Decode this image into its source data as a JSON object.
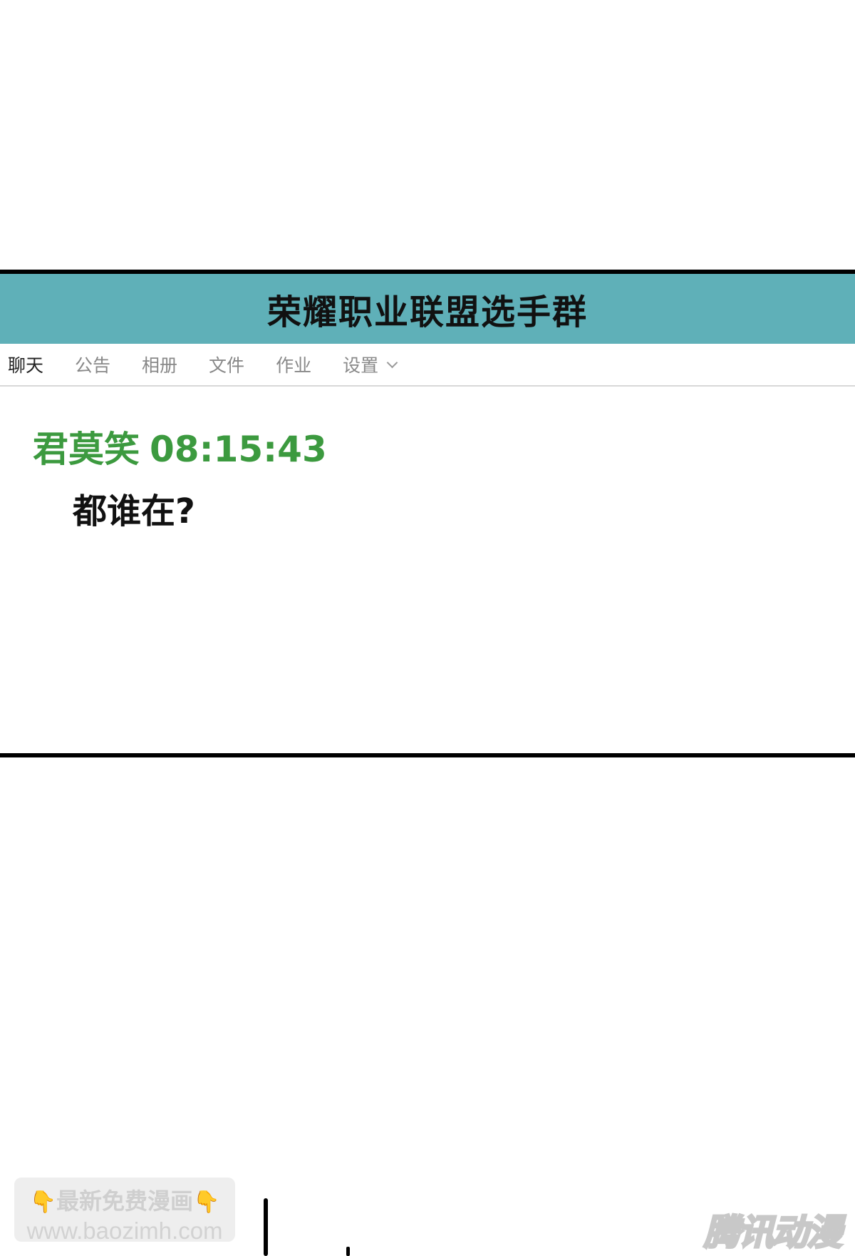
{
  "group": {
    "title": "荣耀职业联盟选手群"
  },
  "tabs": [
    {
      "label": "聊天"
    },
    {
      "label": "公告"
    },
    {
      "label": "相册"
    },
    {
      "label": "文件"
    },
    {
      "label": "作业"
    },
    {
      "label": "设置"
    }
  ],
  "message": {
    "sender": "君莫笑",
    "time": "08:15:43",
    "text": "都谁在?"
  },
  "watermark": {
    "line1": "最新免费漫画",
    "line2": "www.baozimh.com",
    "icon": "pointing-down-hand-icon"
  },
  "logo": {
    "text": "腾讯动漫"
  },
  "colors": {
    "titlebar": "#5fb0b8",
    "sender": "#3c9a3f"
  }
}
